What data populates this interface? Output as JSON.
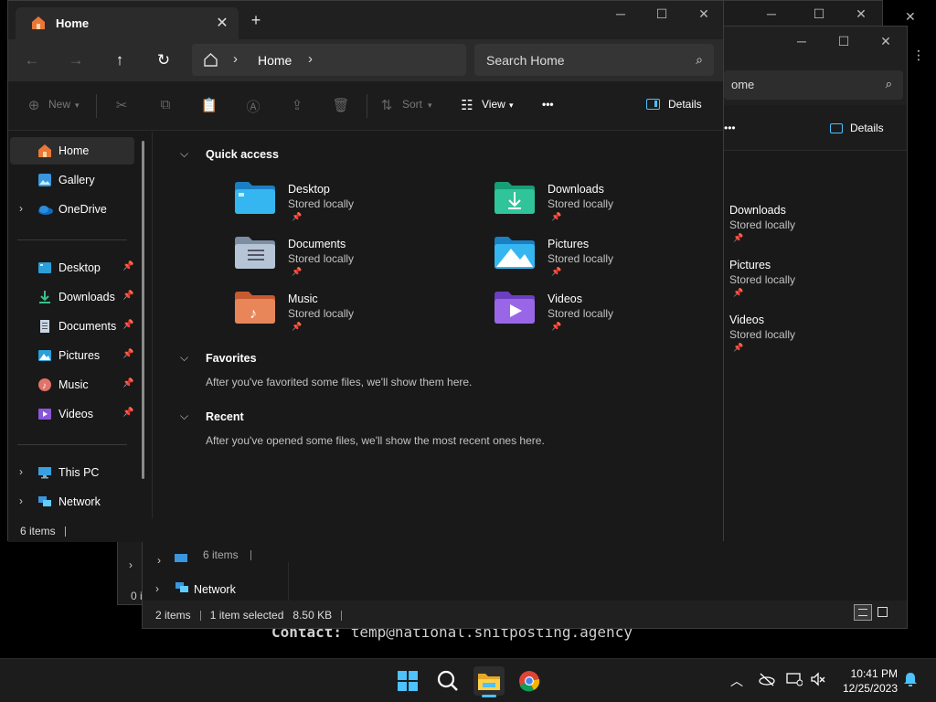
{
  "background_text": {
    "label": "Contact:",
    "value": "temp@national.shitposting.agency"
  },
  "back_window2": {
    "search_value": "ome",
    "details_label": "Details",
    "more_label": "•••",
    "items": [
      {
        "name": "Downloads",
        "sub": "Stored locally"
      },
      {
        "name": "Pictures",
        "sub": "Stored locally"
      },
      {
        "name": "Videos",
        "sub": "Stored locally"
      }
    ],
    "nav_network": "Network",
    "status_items": "2 items",
    "status_selected": "1 item selected",
    "status_size": "8.50 KB"
  },
  "back_window3": {
    "status_items": "6 items",
    "status_partial": "0 i"
  },
  "main": {
    "tab_label": "Home",
    "address": "Home",
    "search_placeholder": "Search Home",
    "cmd": {
      "new": "New",
      "sort": "Sort",
      "view": "View",
      "more": "•••",
      "details": "Details"
    },
    "sidebar": {
      "top": [
        {
          "label": "Home",
          "selected": true
        },
        {
          "label": "Gallery"
        },
        {
          "label": "OneDrive",
          "expandable": true
        }
      ],
      "pinned": [
        {
          "label": "Desktop"
        },
        {
          "label": "Downloads"
        },
        {
          "label": "Documents"
        },
        {
          "label": "Pictures"
        },
        {
          "label": "Music"
        },
        {
          "label": "Videos"
        }
      ],
      "bottom": [
        {
          "label": "This PC"
        },
        {
          "label": "Network"
        }
      ]
    },
    "quick_access": {
      "heading": "Quick access",
      "items": [
        {
          "name": "Desktop",
          "sub": "Stored locally"
        },
        {
          "name": "Downloads",
          "sub": "Stored locally"
        },
        {
          "name": "Documents",
          "sub": "Stored locally"
        },
        {
          "name": "Pictures",
          "sub": "Stored locally"
        },
        {
          "name": "Music",
          "sub": "Stored locally"
        },
        {
          "name": "Videos",
          "sub": "Stored locally"
        }
      ]
    },
    "favorites": {
      "heading": "Favorites",
      "message": "After you've favorited some files, we'll show them here."
    },
    "recent": {
      "heading": "Recent",
      "message": "After you've opened some files, we'll show the most recent ones here."
    },
    "status": "6 items"
  },
  "taskbar": {
    "time": "10:41 PM",
    "date": "12/25/2023"
  },
  "colors": {
    "accent": "#4cc2ff",
    "bg": "#191919",
    "chrome": "#202020"
  }
}
